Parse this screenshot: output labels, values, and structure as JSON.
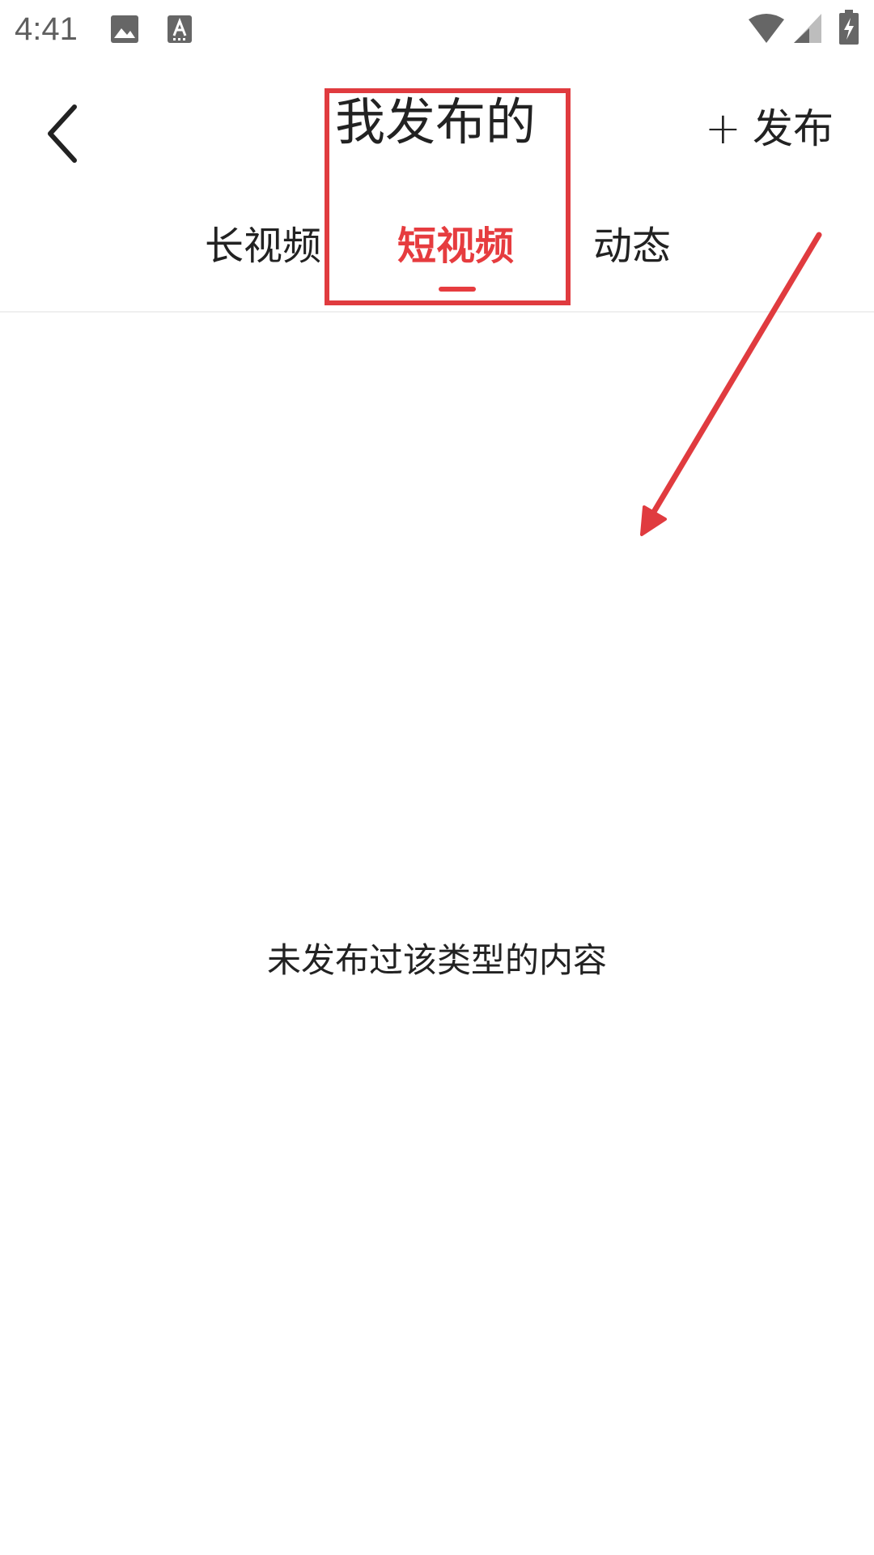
{
  "status_bar": {
    "time": "4:41",
    "icons": [
      "image-icon",
      "text-a-icon",
      "wifi-icon",
      "signal-icon",
      "battery-charging-icon"
    ]
  },
  "header": {
    "back_icon": "chevron-left-icon",
    "title": "我发布的",
    "publish_plus": "+",
    "publish_label": "发布"
  },
  "tabs": [
    {
      "label": "长视频",
      "active": false
    },
    {
      "label": "短视频",
      "active": true
    },
    {
      "label": "动态",
      "active": false
    }
  ],
  "empty_state": {
    "message": "未发布过该类型的内容"
  },
  "colors": {
    "accent": "#e63c3f",
    "annotation": "#e03b3f",
    "text": "#222222",
    "status_text": "#5f5f5f"
  }
}
